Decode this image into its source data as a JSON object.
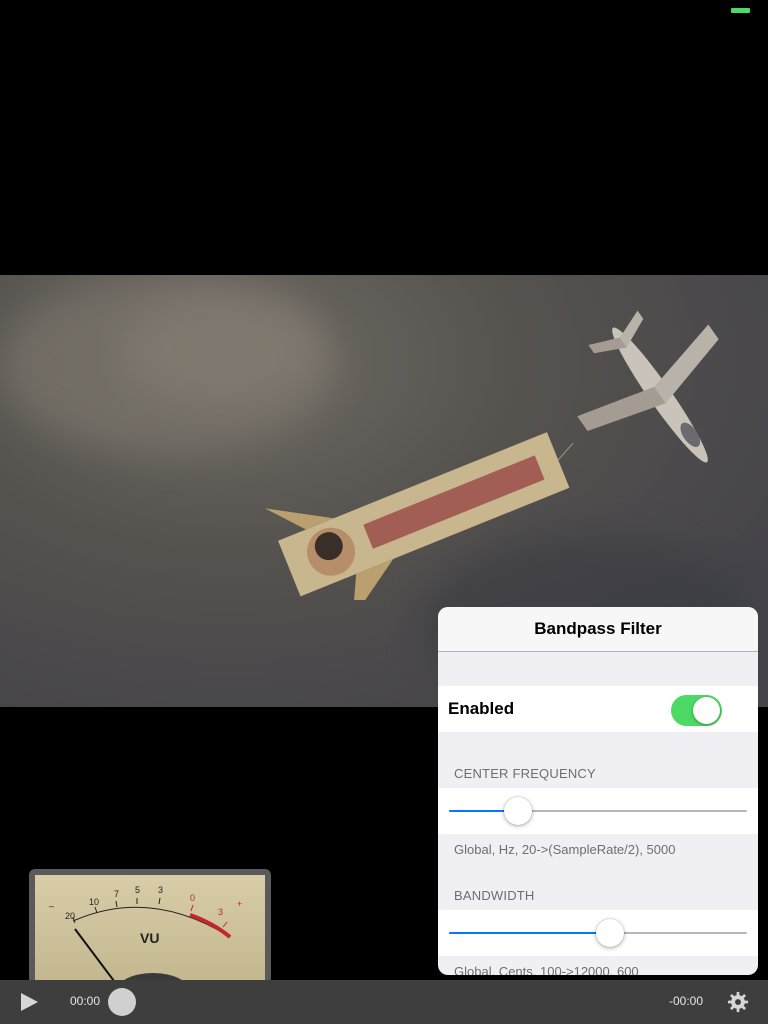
{
  "popover": {
    "title": "Bandpass Filter",
    "enabled_label": "Enabled",
    "enabled": true,
    "sections": [
      {
        "header": "CENTER FREQUENCY",
        "slider_value": 0.23,
        "footer": "Global, Hz, 20->(SampleRate/2), 5000"
      },
      {
        "header": "BANDWIDTH",
        "slider_value": 0.54,
        "footer": "Global, Cents, 100->12000, 600"
      }
    ]
  },
  "vu_meter": {
    "label": "VU",
    "scale": [
      "20",
      "10",
      "7",
      "5",
      "3",
      "0",
      "3"
    ],
    "minus": "–",
    "plus": "+"
  },
  "player": {
    "elapsed": "00:00",
    "remaining": "-00:00",
    "progress": 0.0
  },
  "colors": {
    "accent": "#0079ff",
    "toggle_on": "#4cd964",
    "battery": "#4cd964"
  },
  "icons": {
    "play": "play-icon",
    "settings": "gear-icon"
  }
}
